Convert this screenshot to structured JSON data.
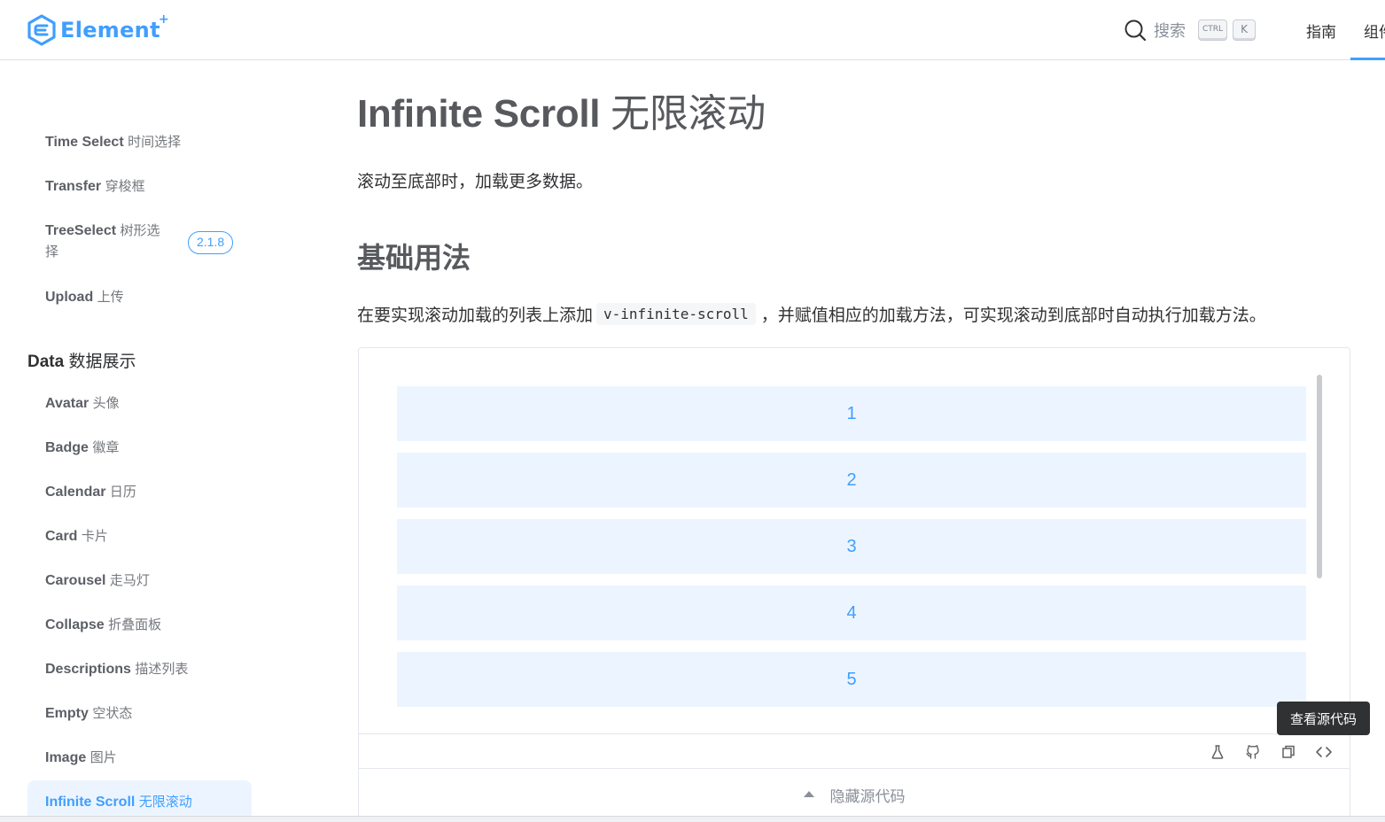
{
  "header": {
    "logo_text": "Element",
    "logo_sup": "+",
    "search_label": "搜索",
    "kbd_ctrl": "CTRL",
    "kbd_k": "K",
    "nav": [
      "指南",
      "组件"
    ]
  },
  "sidebar": {
    "items_top": [
      {
        "en": "Time Select",
        "zh": "时间选择"
      },
      {
        "en": "Transfer",
        "zh": "穿梭框"
      },
      {
        "en": "TreeSelect",
        "zh": "树形选",
        "zh2": "择",
        "badge": "2.1.8"
      },
      {
        "en": "Upload",
        "zh": "上传"
      }
    ],
    "group": {
      "en": "Data",
      "zh": "数据展示"
    },
    "items": [
      {
        "en": "Avatar",
        "zh": "头像"
      },
      {
        "en": "Badge",
        "zh": "徽章"
      },
      {
        "en": "Calendar",
        "zh": "日历"
      },
      {
        "en": "Card",
        "zh": "卡片"
      },
      {
        "en": "Carousel",
        "zh": "走马灯"
      },
      {
        "en": "Collapse",
        "zh": "折叠面板"
      },
      {
        "en": "Descriptions",
        "zh": "描述列表"
      },
      {
        "en": "Empty",
        "zh": "空状态"
      },
      {
        "en": "Image",
        "zh": "图片"
      },
      {
        "en": "Infinite Scroll",
        "zh": "无限滚动"
      }
    ]
  },
  "main": {
    "title_en": "Infinite Scroll",
    "title_zh": "无限滚动",
    "lead": "滚动至底部时，加载更多数据。",
    "section_title": "基础用法",
    "para_before": "在要实现滚动加载的列表上添加",
    "para_code": "v-infinite-scroll",
    "para_after": "，并赋值相应的加载方法，可实现滚动到底部时自动执行加载方法。",
    "demo_items": [
      "1",
      "2",
      "3",
      "4",
      "5"
    ],
    "tooltip": "查看源代码",
    "toggle_label": "隐藏源代码"
  },
  "colors": {
    "accent": "#409eff",
    "item_bg": "#ecf5ff",
    "tooltip_bg": "#303133"
  }
}
